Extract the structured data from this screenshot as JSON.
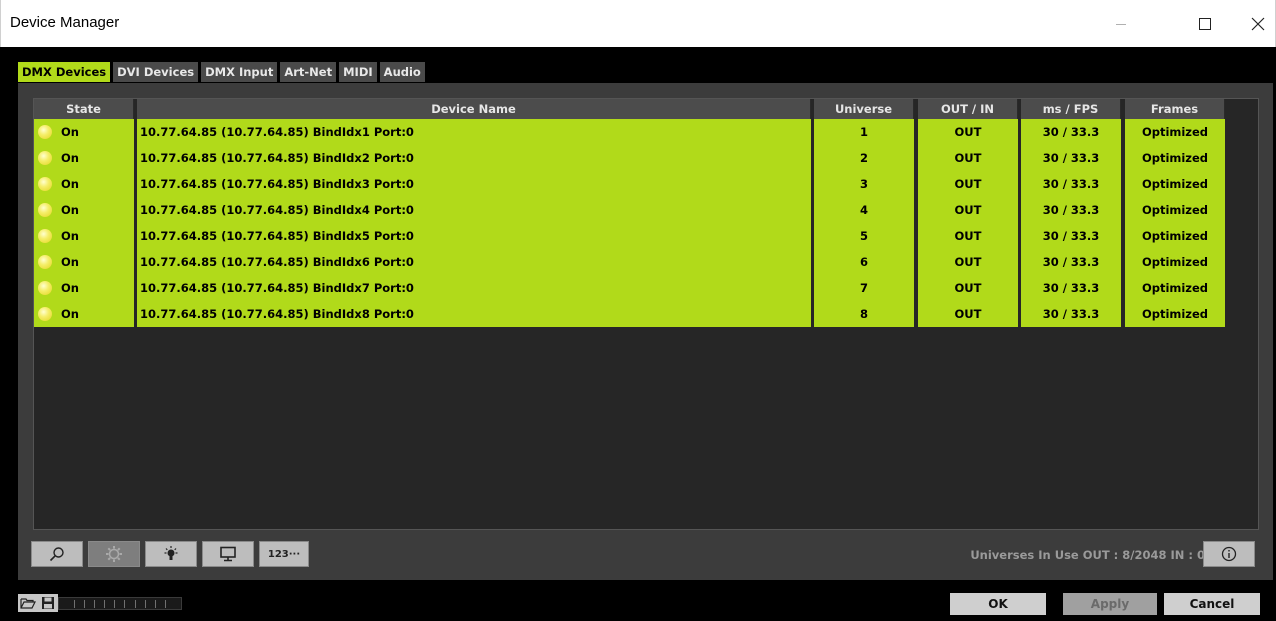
{
  "window": {
    "title": "Device Manager"
  },
  "tabs": [
    {
      "label": "DMX Devices",
      "active": true
    },
    {
      "label": "DVI Devices",
      "active": false
    },
    {
      "label": "DMX Input",
      "active": false
    },
    {
      "label": "Art-Net",
      "active": false
    },
    {
      "label": "MIDI",
      "active": false
    },
    {
      "label": "Audio",
      "active": false
    }
  ],
  "table": {
    "columns": [
      "State",
      "Device Name",
      "Universe",
      "OUT / IN",
      "ms / FPS",
      "Frames"
    ],
    "rows": [
      {
        "state": "On",
        "name": "10.77.64.85 (10.77.64.85) BindIdx1 Port:0",
        "universe": "1",
        "direction": "OUT",
        "ms_fps": "30 / 33.3",
        "frames": "Optimized"
      },
      {
        "state": "On",
        "name": "10.77.64.85 (10.77.64.85) BindIdx2 Port:0",
        "universe": "2",
        "direction": "OUT",
        "ms_fps": "30 / 33.3",
        "frames": "Optimized"
      },
      {
        "state": "On",
        "name": "10.77.64.85 (10.77.64.85) BindIdx3 Port:0",
        "universe": "3",
        "direction": "OUT",
        "ms_fps": "30 / 33.3",
        "frames": "Optimized"
      },
      {
        "state": "On",
        "name": "10.77.64.85 (10.77.64.85) BindIdx4 Port:0",
        "universe": "4",
        "direction": "OUT",
        "ms_fps": "30 / 33.3",
        "frames": "Optimized"
      },
      {
        "state": "On",
        "name": "10.77.64.85 (10.77.64.85) BindIdx5 Port:0",
        "universe": "5",
        "direction": "OUT",
        "ms_fps": "30 / 33.3",
        "frames": "Optimized"
      },
      {
        "state": "On",
        "name": "10.77.64.85 (10.77.64.85) BindIdx6 Port:0",
        "universe": "6",
        "direction": "OUT",
        "ms_fps": "30 / 33.3",
        "frames": "Optimized"
      },
      {
        "state": "On",
        "name": "10.77.64.85 (10.77.64.85) BindIdx7 Port:0",
        "universe": "7",
        "direction": "OUT",
        "ms_fps": "30 / 33.3",
        "frames": "Optimized"
      },
      {
        "state": "On",
        "name": "10.77.64.85 (10.77.64.85) BindIdx8 Port:0",
        "universe": "8",
        "direction": "OUT",
        "ms_fps": "30 / 33.3",
        "frames": "Optimized"
      }
    ]
  },
  "toolbar": {
    "buttons": [
      "search-icon",
      "settings-gear-icon",
      "light-bulb-icon",
      "monitor-icon",
      "numbering-icon"
    ],
    "numbering_label": "123···"
  },
  "status": {
    "universes_text": "Universes In Use OUT : 8/2048  IN : 0"
  },
  "footer": {
    "ok_label": "OK",
    "apply_label": "Apply",
    "cancel_label": "Cancel",
    "apply_enabled": false
  },
  "colors": {
    "accent": "#b1da1a",
    "state_on": "#f0e645",
    "panel": "#3c3c3c",
    "background": "#000000"
  }
}
